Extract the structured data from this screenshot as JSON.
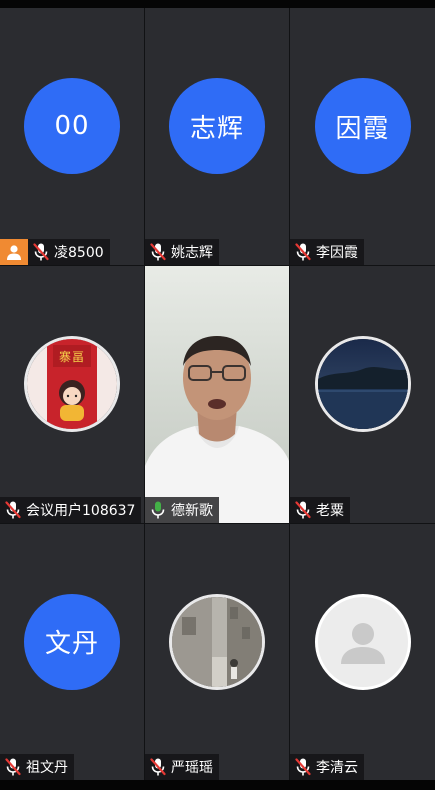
{
  "participants": [
    {
      "avatar_text": "00",
      "name": "凌8500",
      "host": true,
      "mic": "muted"
    },
    {
      "avatar_text": "志辉",
      "name": "姚志辉",
      "mic": "muted"
    },
    {
      "avatar_text": "因霞",
      "name": "李因霞",
      "mic": "muted"
    },
    {
      "avatar_text": "",
      "name": "会议用户108637",
      "mic": "muted"
    },
    {
      "avatar_text": "",
      "name": "德新歌",
      "mic": "active",
      "video": true
    },
    {
      "avatar_text": "",
      "name": "老粟",
      "mic": "muted"
    },
    {
      "avatar_text": "文丹",
      "name": "祖文丹",
      "mic": "muted"
    },
    {
      "avatar_text": "",
      "name": "严瑶瑶",
      "mic": "muted"
    },
    {
      "avatar_text": "",
      "name": "李清云",
      "mic": "muted"
    }
  ],
  "colors": {
    "avatar_blue": "#2f6cf6",
    "host_badge": "#f08a32",
    "mic_muted": "#e53935",
    "mic_active": "#43b047",
    "tile_bg": "#2b2c30"
  }
}
